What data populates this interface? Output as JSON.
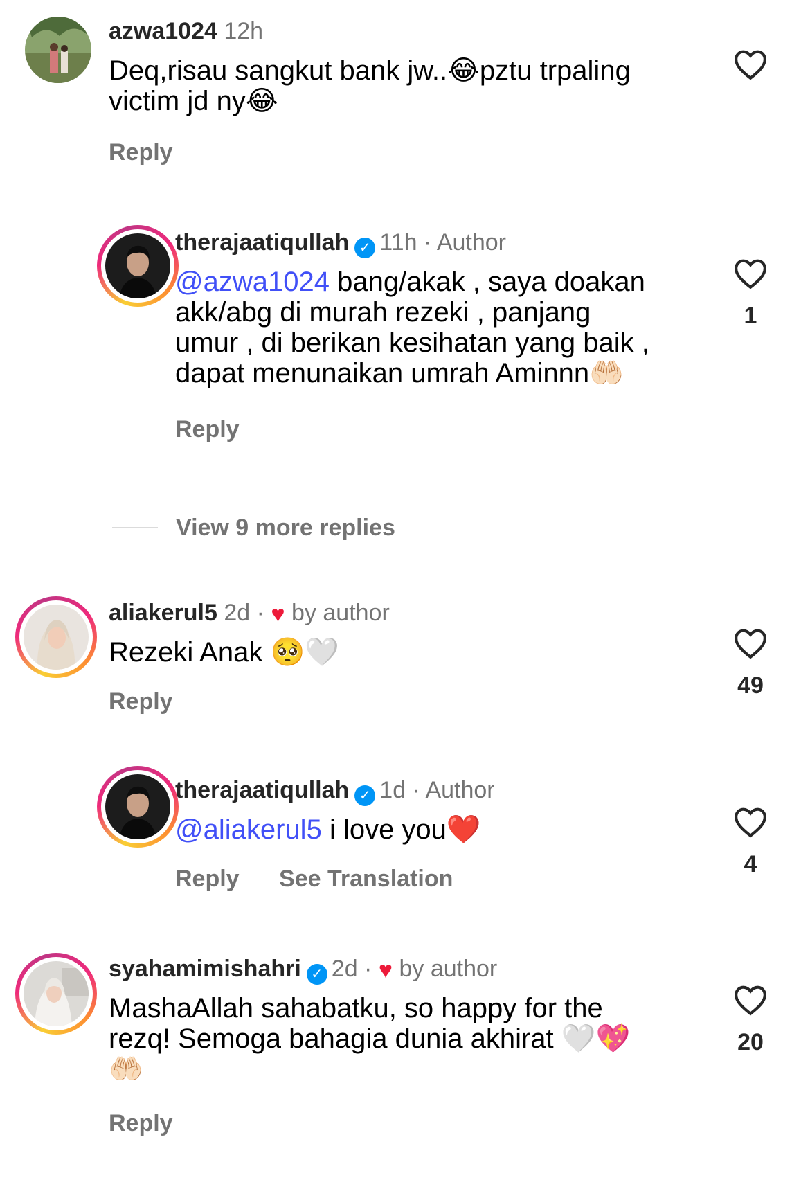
{
  "comments": [
    {
      "username": "azwa1024",
      "meta": "12h",
      "text_lines": [
        "Deq,risau sangkut bank jw..😂pztu trpaling",
        "victim jd ny😂"
      ],
      "reply_label": "Reply",
      "likes": ""
    },
    {
      "username": "therajaatiqullah",
      "meta": "11h · Author",
      "mention": "@azwa1024",
      "text_first": " bang/akak , saya doakan",
      "text_lines": [
        "akk/abg di murah rezeki , panjang",
        "umur , di berikan kesihatan yang baik ,",
        "dapat menunaikan umrah Aminnn🤲🏻"
      ],
      "reply_label": "Reply",
      "likes": "1"
    },
    {
      "username": "aliakerul5",
      "meta": "2d ·",
      "by_author": "by author",
      "text": "Rezeki Anak 🥺🤍",
      "reply_label": "Reply",
      "likes": "49"
    },
    {
      "username": "therajaatiqullah",
      "meta": "1d · Author",
      "mention": "@aliakerul5",
      "text": " i love you❤️",
      "reply_label": "Reply",
      "translate_label": "See Translation",
      "likes": "4"
    },
    {
      "username": "syahamimishahri",
      "meta": "2d ·",
      "by_author": "by author",
      "text_lines": [
        "MashaAllah sahabatku, so happy for the",
        "rezq! Semoga bahagia dunia akhirat 🤍💖",
        "🤲🏻"
      ],
      "reply_label": "Reply",
      "likes": "20"
    }
  ],
  "view_more": "View 9 more replies",
  "colors": {
    "mention": "#4150f7",
    "secondary": "#737373",
    "verified": "#0095f6",
    "heart": "#ed1a3a"
  },
  "icons": [
    "heart-outline-icon",
    "verified-badge-icon",
    "heart-filled-icon"
  ]
}
